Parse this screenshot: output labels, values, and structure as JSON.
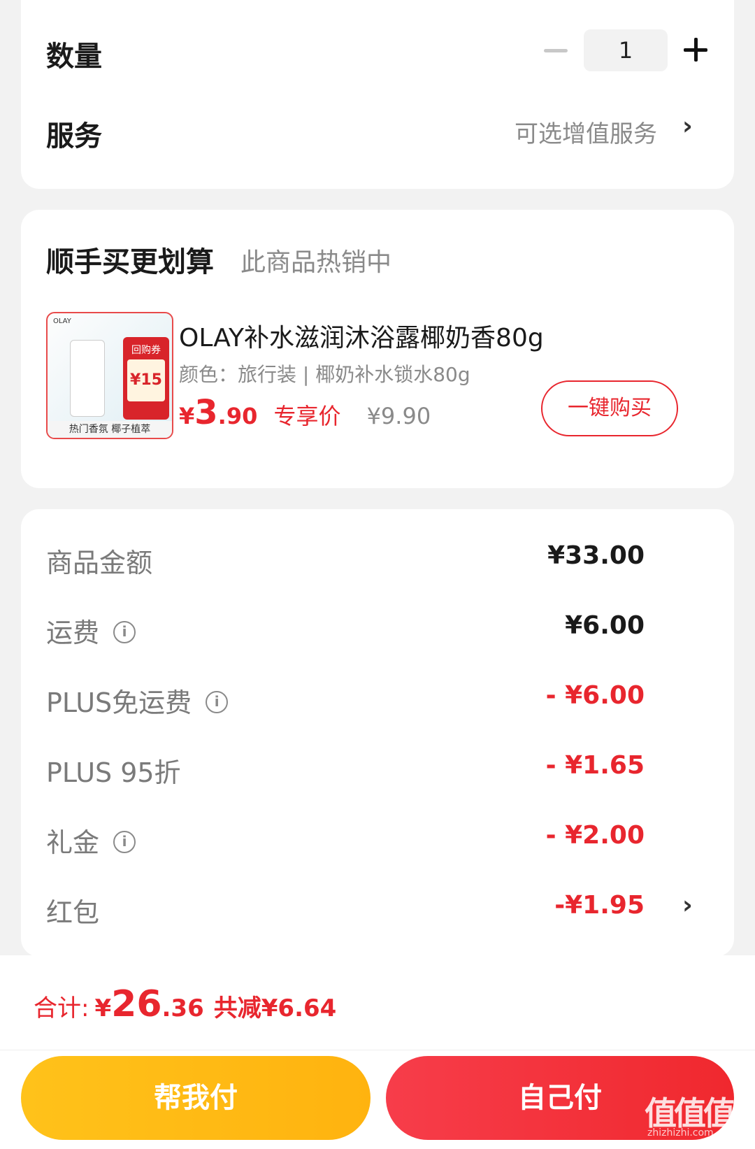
{
  "quantity": {
    "label": "数量",
    "value": "1"
  },
  "service": {
    "label": "服务",
    "hint": "可选增值服务",
    "chevron": "›"
  },
  "bundle": {
    "title": "顺手买更划算",
    "subtitle": "此商品热销中",
    "product": {
      "name": "OLAY补水滋润沐浴露椰奶香80g",
      "spec": "颜色：旅行装 | 椰奶补水锁水80g",
      "price_yen": "¥",
      "price_int": "3",
      "price_dec": ".90",
      "price_tag": "专享价",
      "original_price": "¥9.90",
      "buy_button": "一键购买",
      "thumb": {
        "logo": "OLAY",
        "coupon_label": "回购券",
        "coupon_value": "¥15",
        "strip": "热门香氛 椰子植萃"
      }
    }
  },
  "amounts": {
    "rows": [
      {
        "label": "商品金额",
        "value": "¥33.00",
        "info": false,
        "red": false
      },
      {
        "label": "运费",
        "value": "¥6.00",
        "info": true,
        "red": false
      },
      {
        "label": "PLUS免运费",
        "value": "- ¥6.00",
        "info": true,
        "red": true
      },
      {
        "label": "PLUS 95折",
        "value": "- ¥1.65",
        "info": false,
        "red": true
      },
      {
        "label": "礼金",
        "value": "- ¥2.00",
        "info": true,
        "red": true
      },
      {
        "label": "红包",
        "value": "-¥1.95",
        "info": false,
        "red": true,
        "chevron": "›"
      }
    ]
  },
  "total": {
    "label": "合计:",
    "yen": "¥",
    "int": "26",
    "dec": ".36",
    "saved": "共减¥6.64"
  },
  "buttons": {
    "help_pay": "帮我付",
    "self_pay": "自己付"
  },
  "watermark": {
    "main": "值值值",
    "sub": "zhizhizhi.com"
  },
  "colors": {
    "accent_red": "#e8262e",
    "help_yellow": "#ffb30f",
    "pay_red": "#f0282e"
  }
}
